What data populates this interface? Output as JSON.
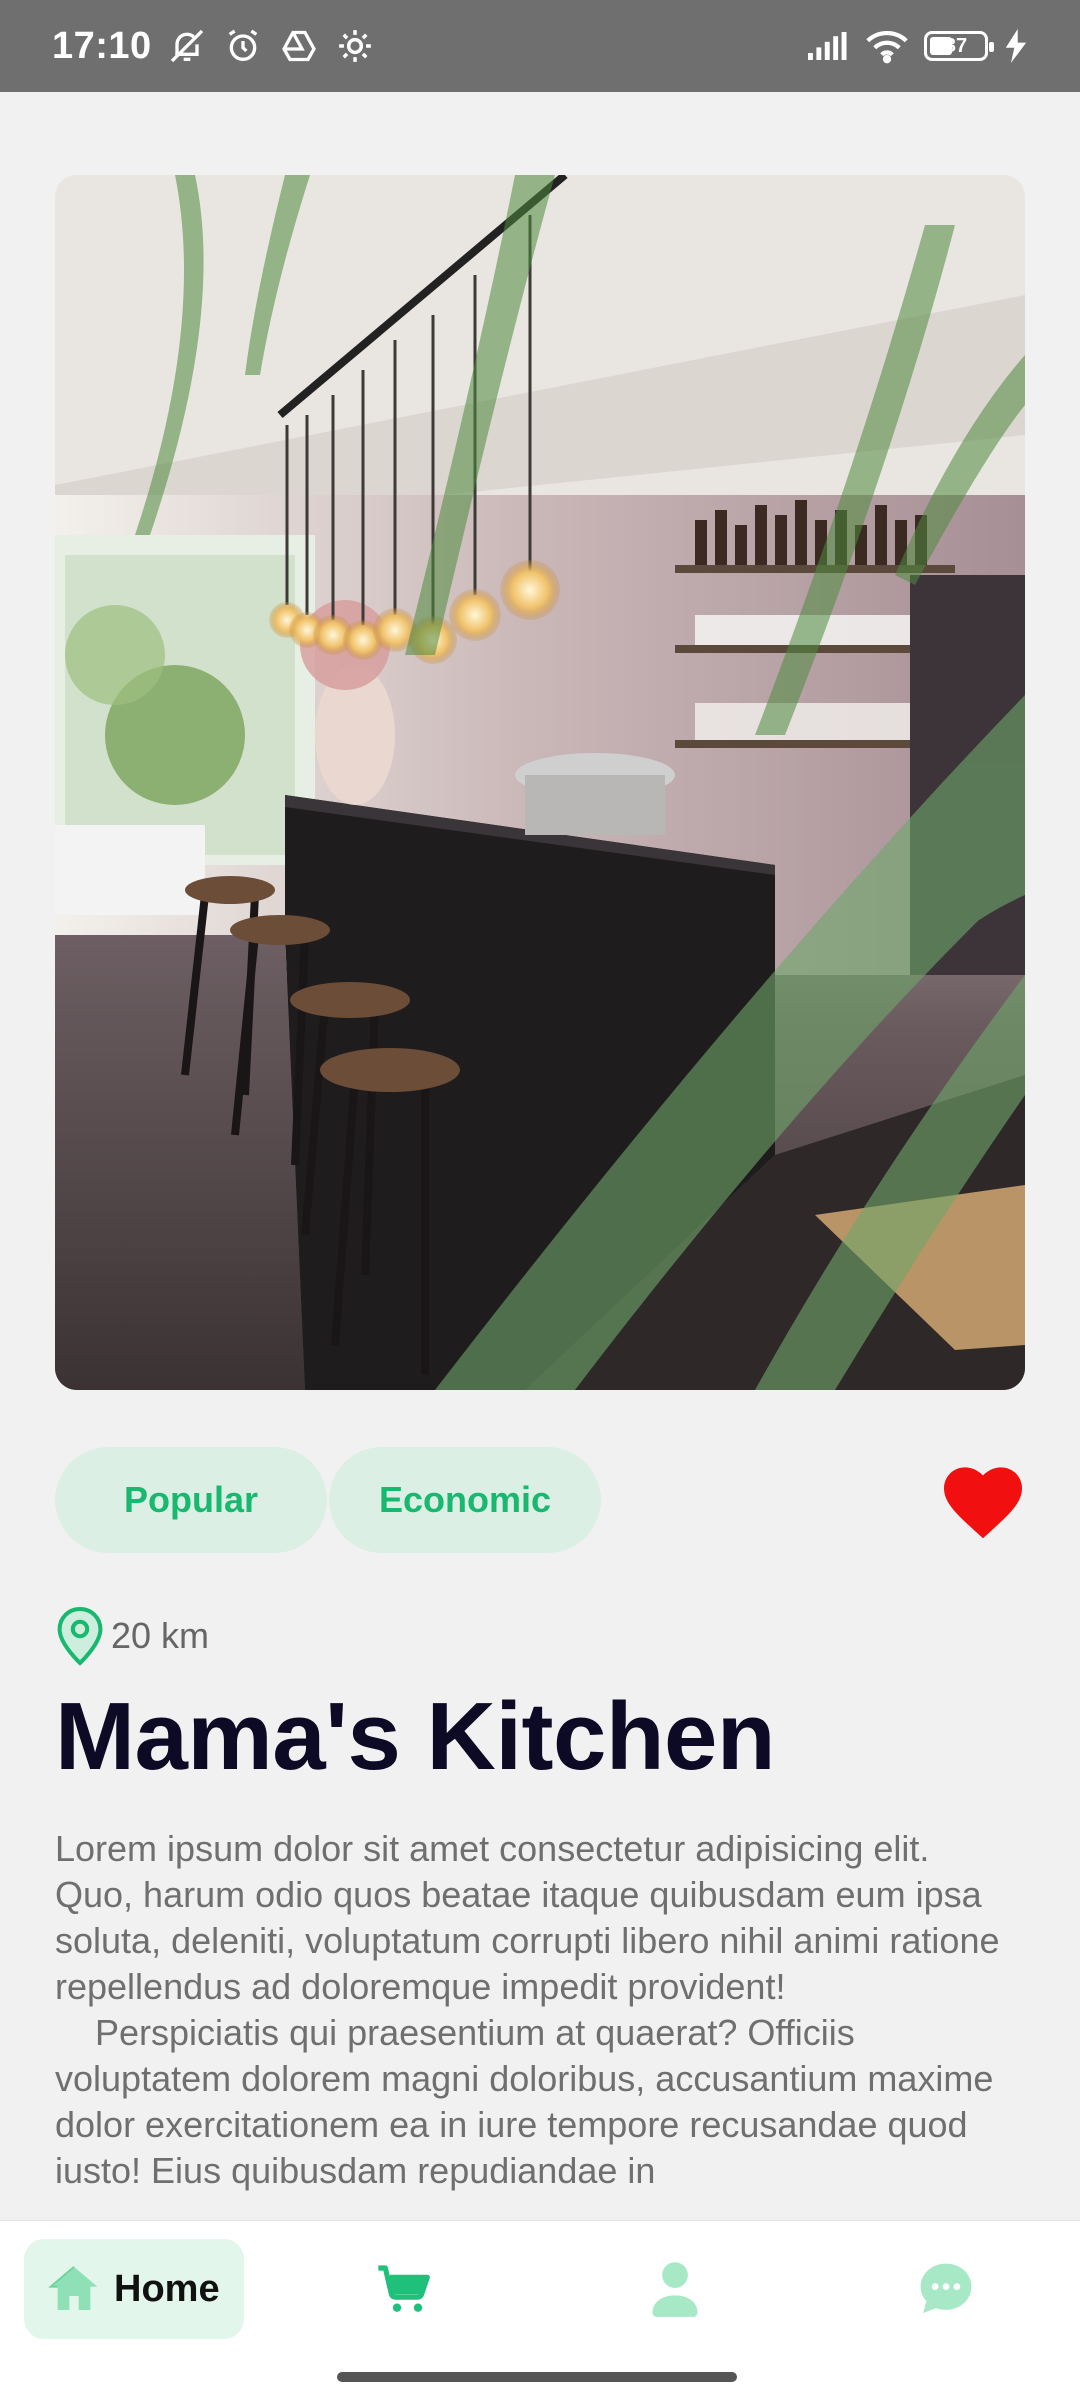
{
  "status_bar": {
    "time": "17:10",
    "battery": "37",
    "icons": [
      "mute-icon",
      "alarm-icon",
      "drive-icon",
      "settings-icon",
      "signal-icon",
      "wifi-icon",
      "battery-icon",
      "charging-icon"
    ]
  },
  "restaurant": {
    "tags": [
      "Popular",
      "Economic"
    ],
    "favorite": true,
    "distance": "20 km",
    "name": "Mama's Kitchen",
    "description_p1": "Lorem ipsum dolor sit amet consectetur adipisicing elit. Quo, harum odio quos beatae itaque quibusdam eum ipsa soluta, deleniti, voluptatum corrupti libero nihil animi ratione repellendus ad doloremque impedit provident!",
    "description_p2": "Perspiciatis qui praesentium at quaerat? Officiis voluptatem dolorem magni doloribus, accusantium maxime dolor exercitationem ea in iure tempore recusandae quod iusto! Eius quibusdam repudiandae in"
  },
  "nav": {
    "home_label": "Home",
    "items": [
      "home-icon",
      "cart-icon",
      "profile-icon",
      "chat-icon"
    ]
  },
  "colors": {
    "accent": "#18b86f",
    "tag_bg": "#dcefe5",
    "heart": "#f20f0f",
    "title": "#0c0a24"
  }
}
